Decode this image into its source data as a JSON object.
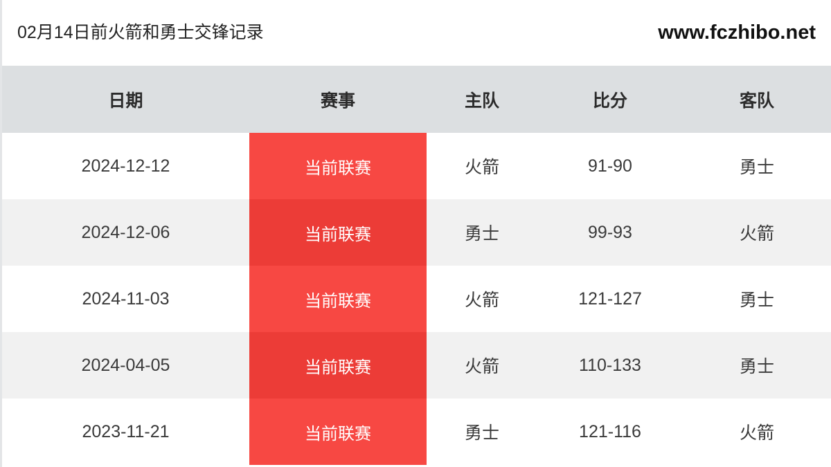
{
  "header": {
    "title": "02月14日前火箭和勇士交锋记录",
    "site_url": "www.fczhibo.net"
  },
  "table": {
    "columns": [
      {
        "key": "date",
        "label": "日期"
      },
      {
        "key": "comp",
        "label": "赛事"
      },
      {
        "key": "home",
        "label": "主队"
      },
      {
        "key": "score",
        "label": "比分"
      },
      {
        "key": "away",
        "label": "客队"
      }
    ],
    "rows": [
      {
        "date": "2024-12-12",
        "comp": "当前联赛",
        "home": "火箭",
        "score": "91-90",
        "away": "勇士"
      },
      {
        "date": "2024-12-06",
        "comp": "当前联赛",
        "home": "勇士",
        "score": "99-93",
        "away": "火箭"
      },
      {
        "date": "2024-11-03",
        "comp": "当前联赛",
        "home": "火箭",
        "score": "121-127",
        "away": "勇士"
      },
      {
        "date": "2024-04-05",
        "comp": "当前联赛",
        "home": "火箭",
        "score": "110-133",
        "away": "勇士"
      },
      {
        "date": "2023-11-21",
        "comp": "当前联赛",
        "home": "勇士",
        "score": "121-116",
        "away": "火箭"
      }
    ]
  },
  "colors": {
    "header_bg": "#dcdfe1",
    "row_alt_bg": "#f1f1f1",
    "competition_red": "#f74843",
    "competition_red_alt": "#ec3c37",
    "text": "#3a3a3a"
  }
}
